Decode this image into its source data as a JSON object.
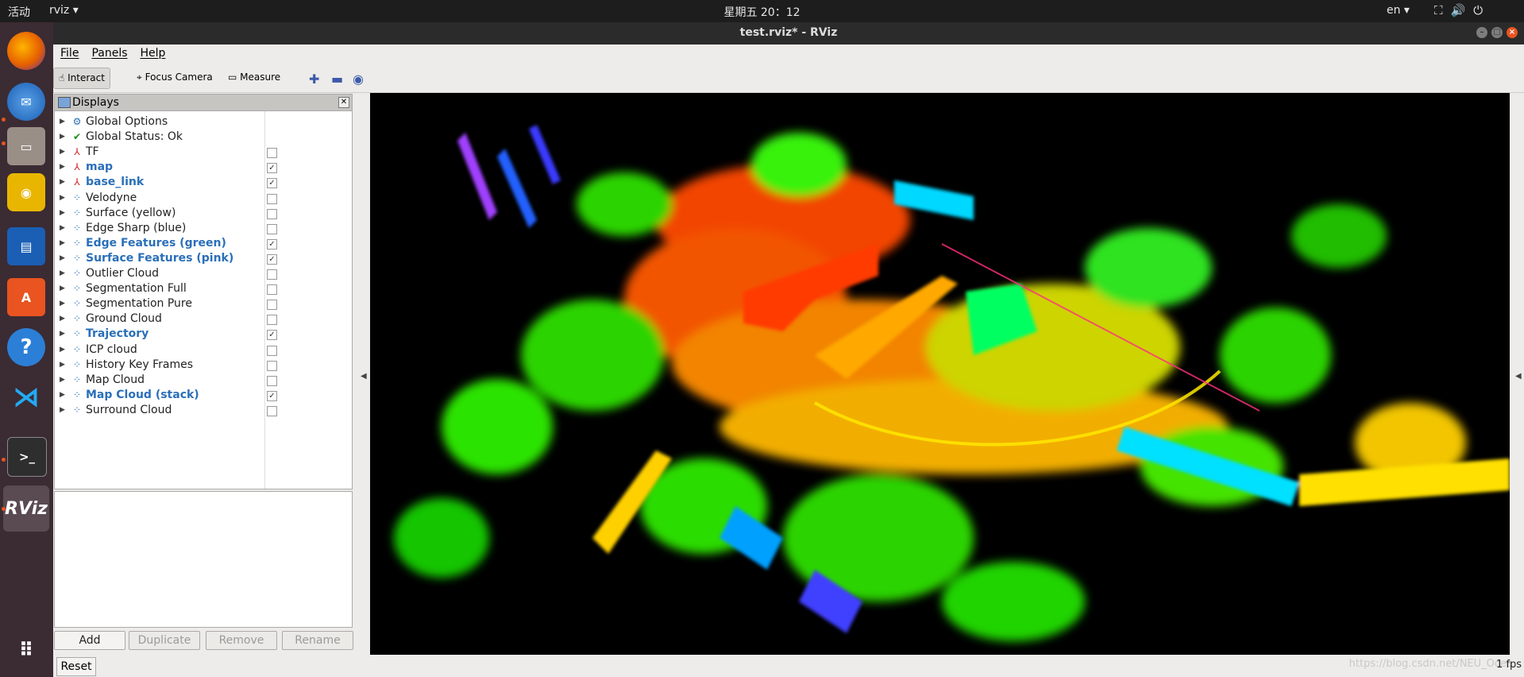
{
  "topbar": {
    "activities": "活动",
    "app_menu": "rviz ▾",
    "clock": "星期五 20：12",
    "lang": "en ▾"
  },
  "window": {
    "title": "test.rviz* - RViz"
  },
  "menu": {
    "file": "File",
    "panels": "Panels",
    "help": "Help"
  },
  "toolbar": {
    "interact": "Interact",
    "focus_camera": "Focus Camera",
    "measure": "Measure"
  },
  "displays": {
    "title": "Displays",
    "items": [
      {
        "label": "Global Options",
        "icon": "gear-icon",
        "checkbox": false,
        "checked": false,
        "bold": false
      },
      {
        "label": "Global Status: Ok",
        "icon": "check-icon",
        "checkbox": false,
        "checked": false,
        "bold": false
      },
      {
        "label": "TF",
        "icon": "axes-icon",
        "checkbox": true,
        "checked": false,
        "bold": false
      },
      {
        "label": "map",
        "icon": "axes-icon",
        "checkbox": true,
        "checked": true,
        "bold": true
      },
      {
        "label": "base_link",
        "icon": "axes-icon",
        "checkbox": true,
        "checked": true,
        "bold": true
      },
      {
        "label": "Velodyne",
        "icon": "pointcloud-icon",
        "checkbox": true,
        "checked": false,
        "bold": false
      },
      {
        "label": "Surface (yellow)",
        "icon": "pointcloud-icon",
        "checkbox": true,
        "checked": false,
        "bold": false
      },
      {
        "label": "Edge Sharp (blue)",
        "icon": "pointcloud-icon",
        "checkbox": true,
        "checked": false,
        "bold": false
      },
      {
        "label": "Edge Features (green)",
        "icon": "pointcloud-icon",
        "checkbox": true,
        "checked": true,
        "bold": true
      },
      {
        "label": "Surface Features (pink)",
        "icon": "pointcloud-icon",
        "checkbox": true,
        "checked": true,
        "bold": true
      },
      {
        "label": "Outlier Cloud",
        "icon": "pointcloud-icon",
        "checkbox": true,
        "checked": false,
        "bold": false
      },
      {
        "label": "Segmentation Full",
        "icon": "pointcloud-icon",
        "checkbox": true,
        "checked": false,
        "bold": false
      },
      {
        "label": "Segmentation Pure",
        "icon": "pointcloud-icon",
        "checkbox": true,
        "checked": false,
        "bold": false
      },
      {
        "label": "Ground Cloud",
        "icon": "pointcloud-icon",
        "checkbox": true,
        "checked": false,
        "bold": false
      },
      {
        "label": "Trajectory",
        "icon": "pointcloud-icon",
        "checkbox": true,
        "checked": true,
        "bold": true
      },
      {
        "label": "ICP cloud",
        "icon": "pointcloud-icon",
        "checkbox": true,
        "checked": false,
        "bold": false
      },
      {
        "label": "History Key Frames",
        "icon": "pointcloud-icon",
        "checkbox": true,
        "checked": false,
        "bold": false
      },
      {
        "label": "Map Cloud",
        "icon": "pointcloud-icon",
        "checkbox": true,
        "checked": false,
        "bold": false
      },
      {
        "label": "Map Cloud (stack)",
        "icon": "pointcloud-icon",
        "checkbox": true,
        "checked": true,
        "bold": true
      },
      {
        "label": "Surround Cloud",
        "icon": "pointcloud-icon",
        "checkbox": true,
        "checked": false,
        "bold": false
      }
    ],
    "buttons": {
      "add": "Add",
      "duplicate": "Duplicate",
      "remove": "Remove",
      "rename": "Rename"
    }
  },
  "status": {
    "reset": "Reset",
    "fps": "1 fps",
    "watermark": "https://blog.csdn.net/NEU_Ocea"
  },
  "dock_icons": [
    "firefox-icon",
    "thunderbird-icon",
    "files-icon",
    "rhythmbox-icon",
    "writer-icon",
    "software-icon",
    "help-icon",
    "vscode-icon",
    "terminal-icon",
    "rviz-icon",
    "app-grid-icon"
  ],
  "accent_colors": {
    "ubuntu_orange": "#e95420",
    "active_label": "#2a6fb8"
  }
}
